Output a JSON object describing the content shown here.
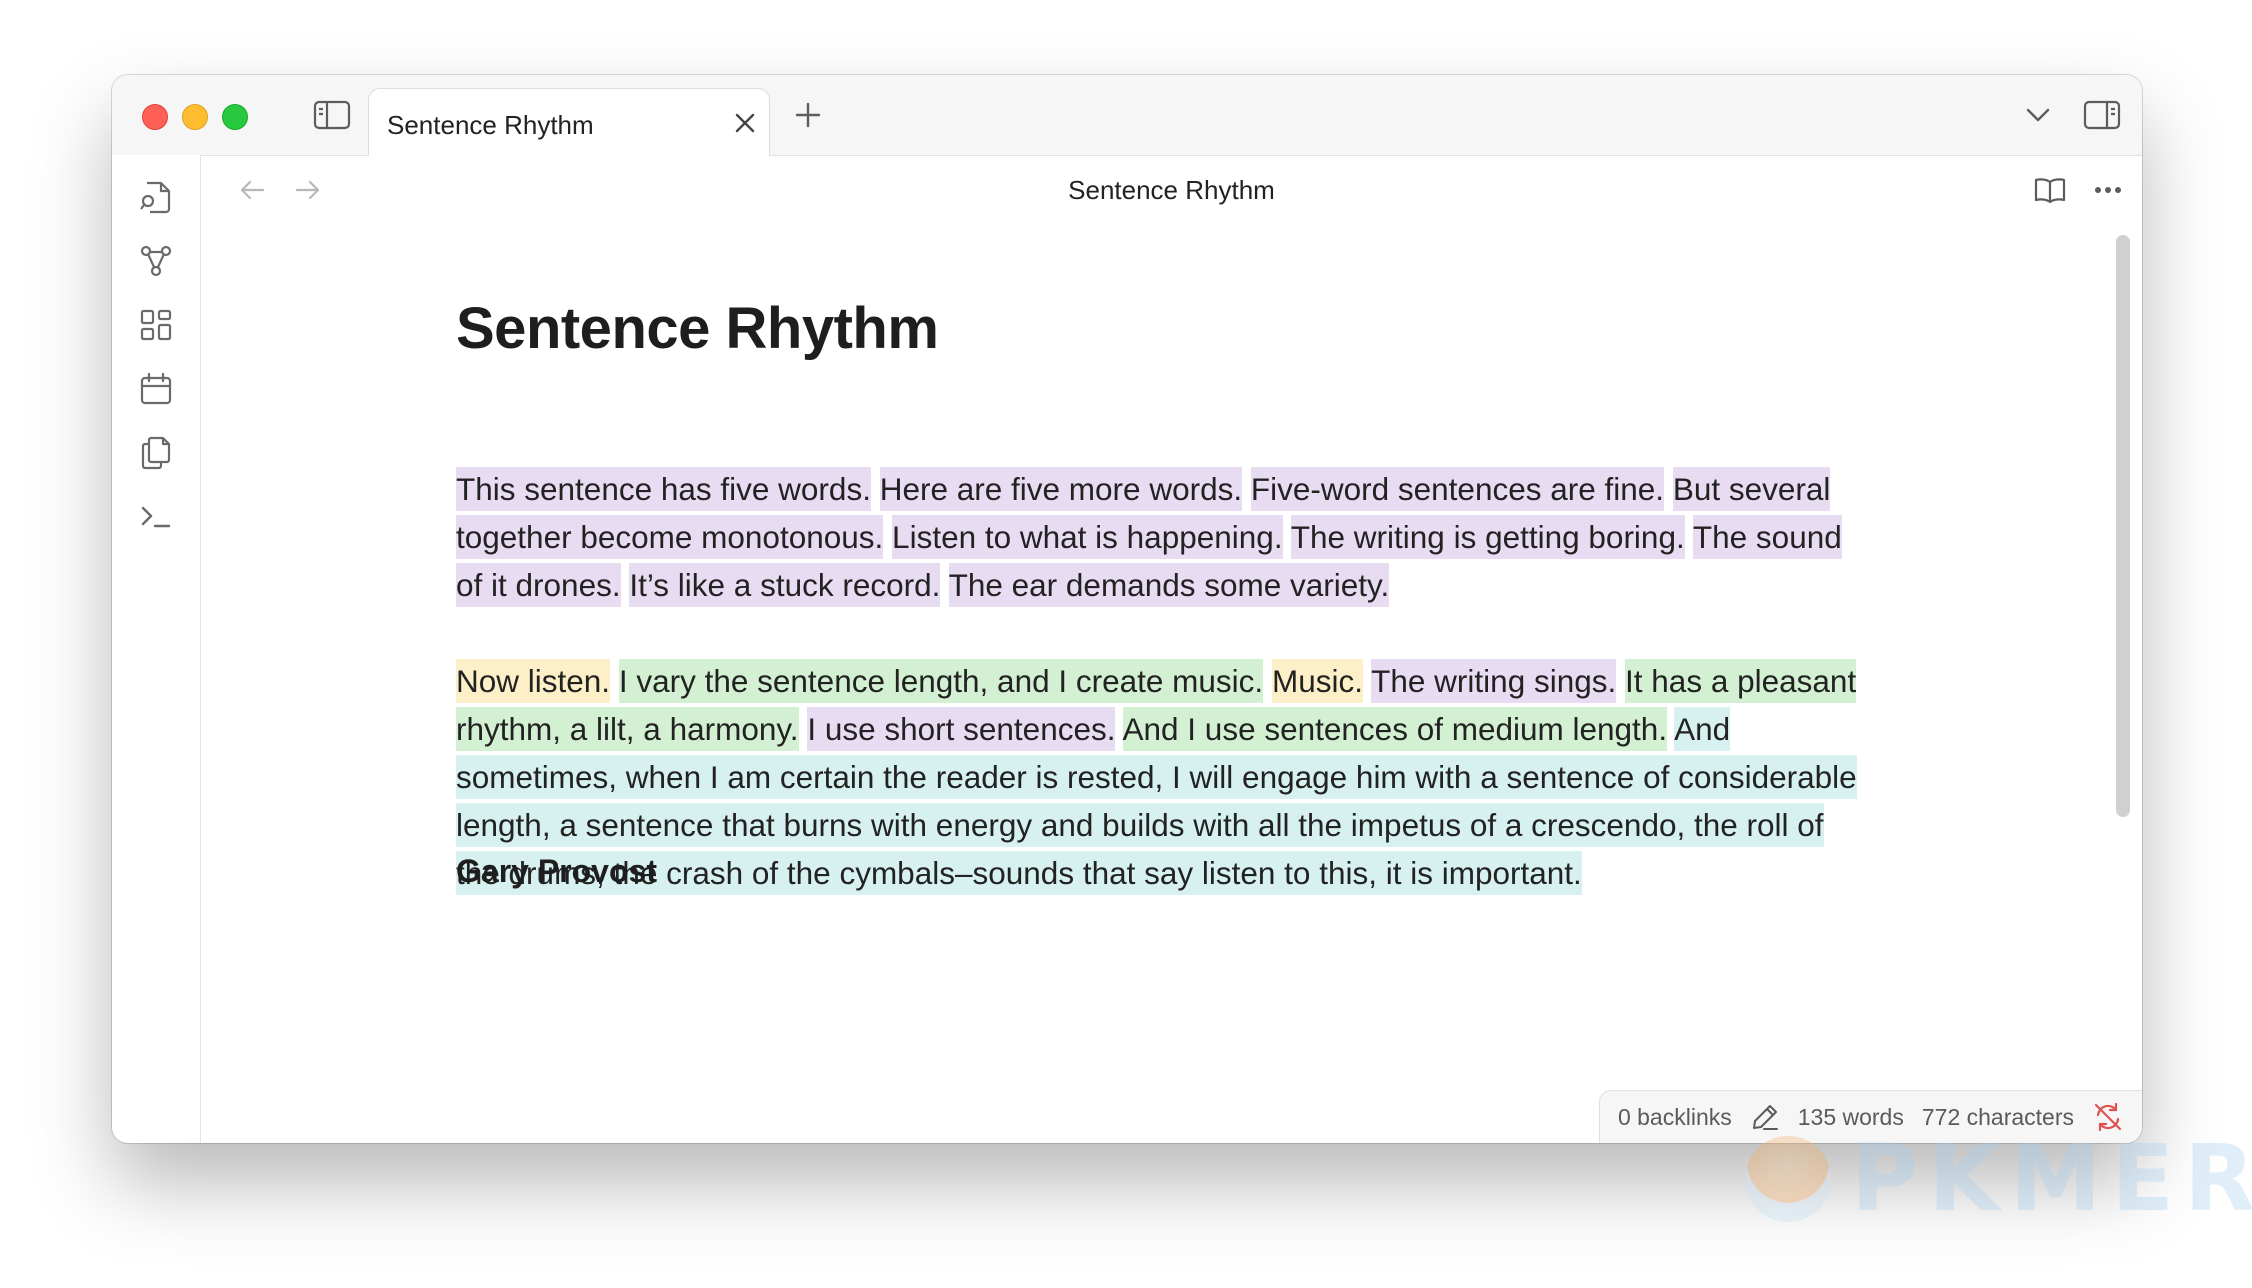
{
  "window": {
    "tab_title": "Sentence Rhythm",
    "view_title": "Sentence Rhythm"
  },
  "icons": {
    "sidebar_toggle": "sidebar-left-icon",
    "close_tab": "close-icon",
    "new_tab": "plus-icon",
    "tab_list": "chevron-down-icon",
    "right_sidebar": "sidebar-right-icon",
    "back": "arrow-left-icon",
    "forward": "arrow-right-icon",
    "reading_view": "book-open-icon",
    "more_options": "more-horizontal-icon",
    "rail": [
      "search-file-icon",
      "graph-icon",
      "canvas-icon",
      "calendar-icon",
      "copy-icon",
      "terminal-icon"
    ],
    "status_edit": "pencil-icon",
    "sync_off": "sync-off-icon"
  },
  "document": {
    "title": "Sentence Rhythm",
    "paragraph1": [
      {
        "text": "This sentence has five words.",
        "highlight": "purple"
      },
      {
        "text": "Here are five more words.",
        "highlight": "purple"
      },
      {
        "text": "Five-word sentences are fine.",
        "highlight": "purple"
      },
      {
        "text": "But several together become monotonous.",
        "highlight": "purple"
      },
      {
        "text": "Listen to what is happening.",
        "highlight": "purple"
      },
      {
        "text": "The writing is getting boring.",
        "highlight": "purple"
      },
      {
        "text": "The sound of it drones.",
        "highlight": "purple"
      },
      {
        "text": "It’s like a stuck record.",
        "highlight": "purple"
      },
      {
        "text": "The ear demands some variety.",
        "highlight": "purple"
      }
    ],
    "paragraph2": [
      {
        "text": "Now listen.",
        "highlight": "yellow"
      },
      {
        "text": "I vary the sentence length, and I create music.",
        "highlight": "green"
      },
      {
        "text": "Music.",
        "highlight": "yellow"
      },
      {
        "text": "The writing sings.",
        "highlight": "purple"
      },
      {
        "text": "It has a pleasant rhythm, a lilt, a harmony.",
        "highlight": "green"
      },
      {
        "text": "I use short sentences.",
        "highlight": "purple"
      },
      {
        "text": "And I use sentences of medium length.",
        "highlight": "green"
      },
      {
        "text": "And sometimes, when I am certain the reader is rested, I will engage him with a sentence of considerable length, a sentence that burns with energy and builds with all the impetus of a crescendo, the roll of the drums, the crash of the cymbals–sounds that say listen to this, it is important.",
        "highlight": "cyan"
      }
    ],
    "author": "Gary Provost"
  },
  "status": {
    "backlinks": "0 backlinks",
    "words": "135 words",
    "characters": "772 characters"
  },
  "watermark": "PKMER",
  "colors": {
    "purple": "#e8dcf3",
    "yellow": "#fdf0c8",
    "green": "#d3f0d2",
    "cyan": "#d6f1ef",
    "sync_off": "#e05252"
  }
}
